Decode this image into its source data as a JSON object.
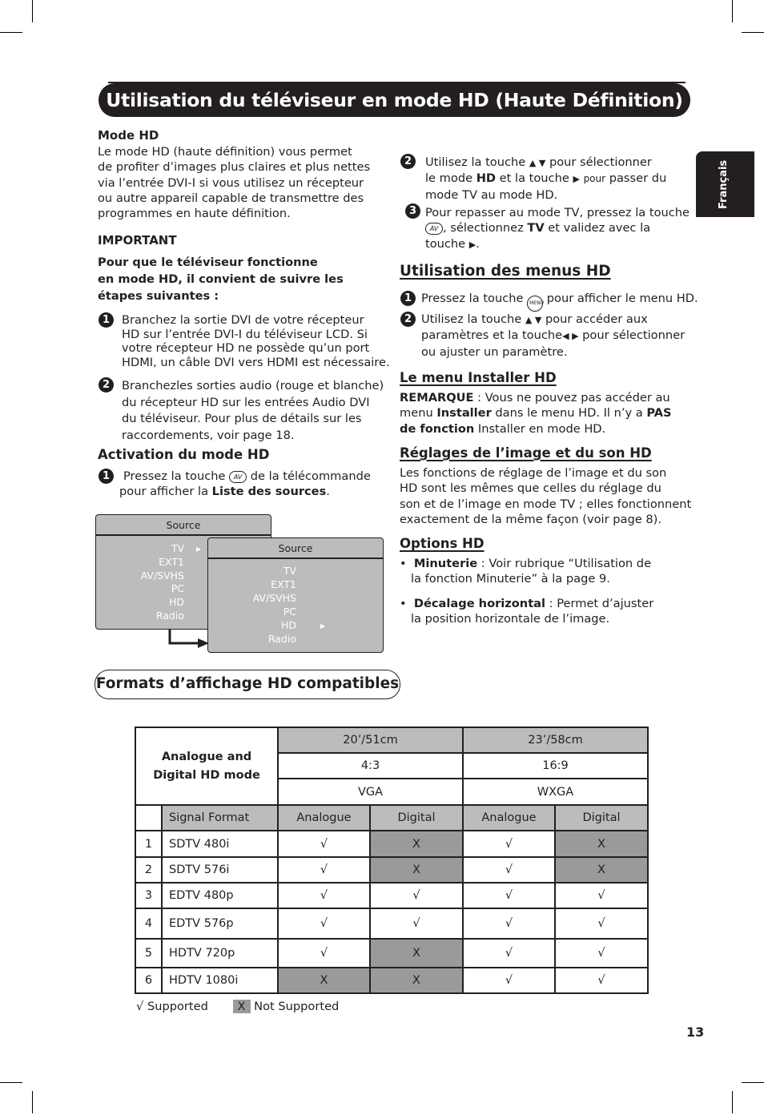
{
  "page_title": "Utilisation du téléviseur en mode HD (Haute Définition)",
  "language_tab": "Français",
  "left_column": {
    "mode_hd": {
      "heading": "Mode HD",
      "lines": [
        "Le mode HD (haute définition) vous permet",
        "de profiter d’images plus claires et plus nettes",
        "via l’entrée DVI-I si vous utilisez un récepteur",
        "ou autre appareil capable de transmettre des",
        "programmes en haute définition."
      ]
    },
    "important": {
      "heading": "IMPORTANT",
      "lines": [
        "Pour que le téléviseur fonctionne",
        "en mode HD, il convient de suivre les",
        "étapes suivantes :"
      ]
    },
    "steps": [
      {
        "number": "1",
        "lines": [
          "Branchez la sortie DVI de votre récepteur",
          "HD sur l’entrée DVI-I du téléviseur LCD. Si",
          "votre récepteur HD ne possède qu’un port",
          "HDMI, un câble DVI vers HDMI est nécessaire."
        ]
      },
      {
        "number": "2",
        "lines": [
          "Branchezles sorties audio (rouge et blanche)",
          "du récepteur HD sur les entrées Audio DVI",
          "du téléviseur. Pour plus de détails sur les",
          "raccordements, voir page 18."
        ]
      }
    ],
    "activation": {
      "heading": "Activation du mode HD",
      "step_number": "1",
      "line1_before": "Pressez la touche",
      "key_label": "AV",
      "line1_after": "de la télécommande",
      "line2_before": "pour afficher la",
      "line2_bold": "Liste des sources",
      "line2_after": "."
    }
  },
  "source_menus": [
    {
      "title": "Source",
      "items": [
        "TV",
        "EXT1",
        "AV/SVHS",
        "PC",
        "HD",
        "Radio"
      ],
      "selected": "TV",
      "arrow_icon": "▶"
    },
    {
      "title": "Source",
      "items": [
        "TV",
        "EXT1",
        "AV/SVHS",
        "PC",
        "HD",
        "Radio"
      ],
      "selected": "HD",
      "arrow_icon": "▶"
    }
  ],
  "right_column": {
    "step2": {
      "number": "2",
      "l1_before": "Utilisez la touche",
      "l1_icons": "▲ ▼",
      "l1_after": "pour sélectionner",
      "l2_before": "le mode",
      "l2_bold": "HD",
      "l2_mid": "et la touche",
      "l2_icon": "▶",
      "l2_small": "pour",
      "l2_after": "passer du",
      "l3": "mode TV au mode HD."
    },
    "step3": {
      "number": "3",
      "l1": "Pour repasser au mode TV, pressez la touche",
      "key_label": "AV",
      "l2_before": ", sélectionnez",
      "l2_bold": "TV",
      "l2_after": "et validez avec la",
      "l3_before": "touche",
      "l3_icon": "▶",
      "l3_after": "."
    },
    "menus_hd": {
      "heading": "Utilisation des menus HD",
      "step1": {
        "number": "1",
        "before": "Pressez la touche",
        "key_label": "MENU",
        "after": "pour afficher le menu HD."
      },
      "step2": {
        "number": "2",
        "l1_before": "Utilisez la touche",
        "l1_icons": "▲ ▼",
        "l1_after": "pour accéder aux",
        "l2_before": "paramètres et la touche",
        "l2_icons": "◀ ▶",
        "l2_after": "pour sélectionner",
        "l3": "ou ajuster un paramètre."
      }
    },
    "installer": {
      "heading": "Le menu Installer HD",
      "l1_bold": "REMARQUE",
      "l1_after": " : Vous ne pouvez pas accéder au",
      "l2_before": "menu ",
      "l2_bold": "Installer",
      "l2_mid": " dans le menu HD. Il n’y a ",
      "l2_bold2": "PAS",
      "l3_bold": "de fonction",
      "l3_after": " Installer en mode HD."
    },
    "reglages": {
      "heading": "Réglages de l’image et du son HD",
      "lines": [
        "Les fonctions de réglage de l’image et du son",
        "HD sont les mêmes que celles du réglage du",
        "son et de l’image en mode TV ; elles fonctionnent",
        "exactement de la même façon (voir page 8)."
      ]
    },
    "options": {
      "heading": "Options HD",
      "bullets": [
        {
          "bold": "Minuterie",
          "l1_after": " : Voir rubrique “Utilisation de",
          "l2": "la fonction Minuterie” à la page 9."
        },
        {
          "bold": "Décalage horizontal",
          "l1_after": " : Permet d’ajuster",
          "l2": "la position horizontale de l’image."
        }
      ]
    }
  },
  "formats_section": {
    "heading": "Formats d’affichage HD compatibles",
    "table": {
      "corner_label_l1": "Analogue and",
      "corner_label_l2": "Digital HD mode",
      "sizes": [
        "20’/51cm",
        "23’/58cm"
      ],
      "ratios": [
        "4:3",
        "16:9"
      ],
      "resolutions": [
        "VGA",
        "WXGA"
      ],
      "signal_header": "Signal Format",
      "sub_headers": [
        "Analogue",
        "Digital",
        "Analogue",
        "Digital"
      ],
      "rows": [
        {
          "index": "1",
          "format": "SDTV 480i",
          "values": [
            "√",
            "X",
            "√",
            "X"
          ]
        },
        {
          "index": "2",
          "format": "SDTV 576i",
          "values": [
            "√",
            "X",
            "√",
            "X"
          ]
        },
        {
          "index": "3",
          "format": "EDTV 480p",
          "values": [
            "√",
            "√",
            "√",
            "√"
          ]
        },
        {
          "index": "4",
          "format": "EDTV 576p",
          "values": [
            "√",
            "√",
            "√",
            "√"
          ]
        },
        {
          "index": "5",
          "format": "HDTV 720p",
          "values": [
            "√",
            "X",
            "√",
            "√"
          ]
        },
        {
          "index": "6",
          "format": "HDTV 1080i",
          "values": [
            "X",
            "X",
            "√",
            "√"
          ]
        }
      ]
    },
    "legend": {
      "supported_symbol": "√",
      "supported_label": "Supported",
      "not_supported_symbol": "X",
      "not_supported_label": "Not Supported"
    }
  },
  "page_number": "13",
  "colors": {
    "ink": "#231f20",
    "header_grey": "#bdbcbc",
    "not_supported_grey": "#9a9a9a"
  }
}
